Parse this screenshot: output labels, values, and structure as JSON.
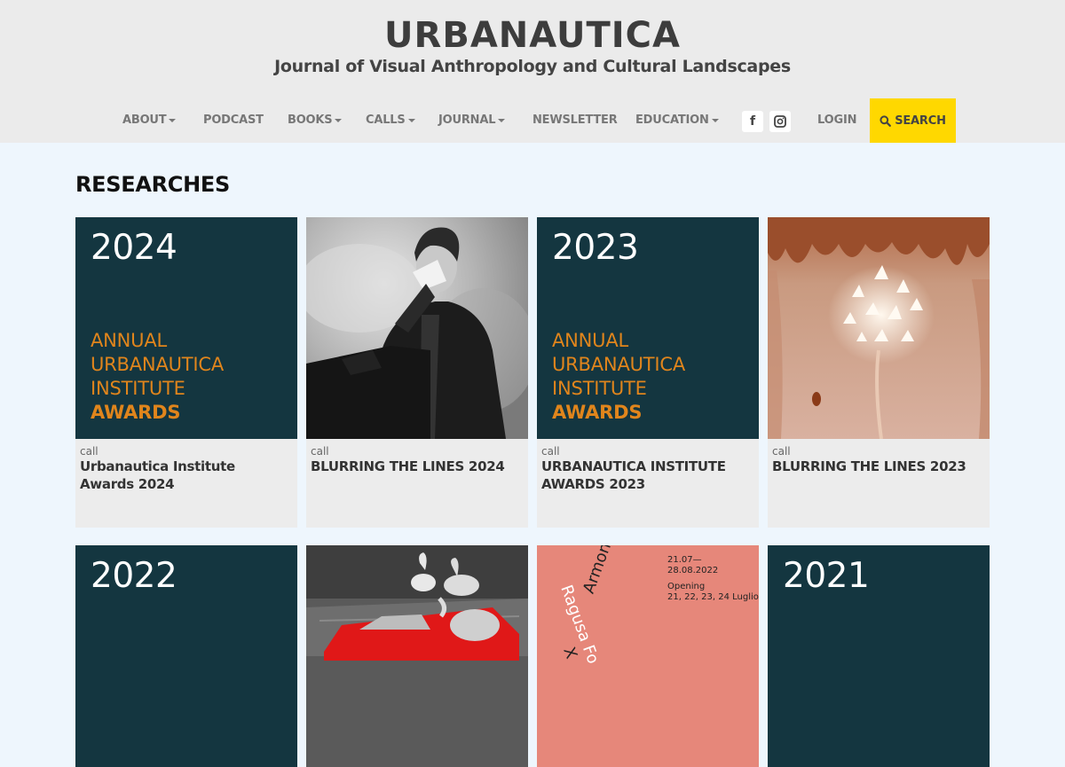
{
  "header": {
    "title": "URBANAUTICA",
    "subtitle": "Journal of Visual Anthropology and Cultural Landscapes"
  },
  "nav": {
    "items": [
      {
        "label": "ABOUT",
        "dropdown": true
      },
      {
        "label": "PODCAST",
        "dropdown": false
      },
      {
        "label": "BOOKS",
        "dropdown": true
      },
      {
        "label": "CALLS",
        "dropdown": true
      },
      {
        "label": "JOURNAL",
        "dropdown": true
      },
      {
        "label": "NEWSLETTER",
        "dropdown": false
      },
      {
        "label": "EDUCATION",
        "dropdown": true
      }
    ],
    "facebook_icon": "f",
    "login": "LOGIN",
    "search": "SEARCH",
    "search_color": "#ffd800"
  },
  "section": {
    "title": "RESEARCHES"
  },
  "cards": [
    {
      "year": "2024",
      "lines": [
        "ANNUAL",
        "URBANAUTICA",
        "INSTITUTE"
      ],
      "bold_line": "AWARDS",
      "kind": "call",
      "title": "Urbanautica Institute Awards 2024"
    },
    {
      "kind": "call",
      "title": "BLURRING THE LINES 2024"
    },
    {
      "year": "2023",
      "lines": [
        "ANNUAL",
        "URBANAUTICA",
        "INSTITUTE"
      ],
      "bold_line": "AWARDS",
      "kind": "call",
      "title": "URBANAUTICA INSTITUTE AWARDS 2023"
    },
    {
      "kind": "call",
      "title": "BLURRING THE LINES 2023"
    },
    {
      "year": "2022"
    },
    {},
    {
      "poster_dates": "21.07—\n28.08.2022",
      "poster_opening": "Opening\n21, 22, 23, 24 Luglio",
      "poster_word1": "Armonia",
      "poster_word2": "Ragusa Fo",
      "poster_word3": "X"
    },
    {
      "year": "2021"
    }
  ],
  "colors": {
    "award_bg": "#143640",
    "award_text": "#e0851c",
    "poster_bg": "#e6877a"
  }
}
